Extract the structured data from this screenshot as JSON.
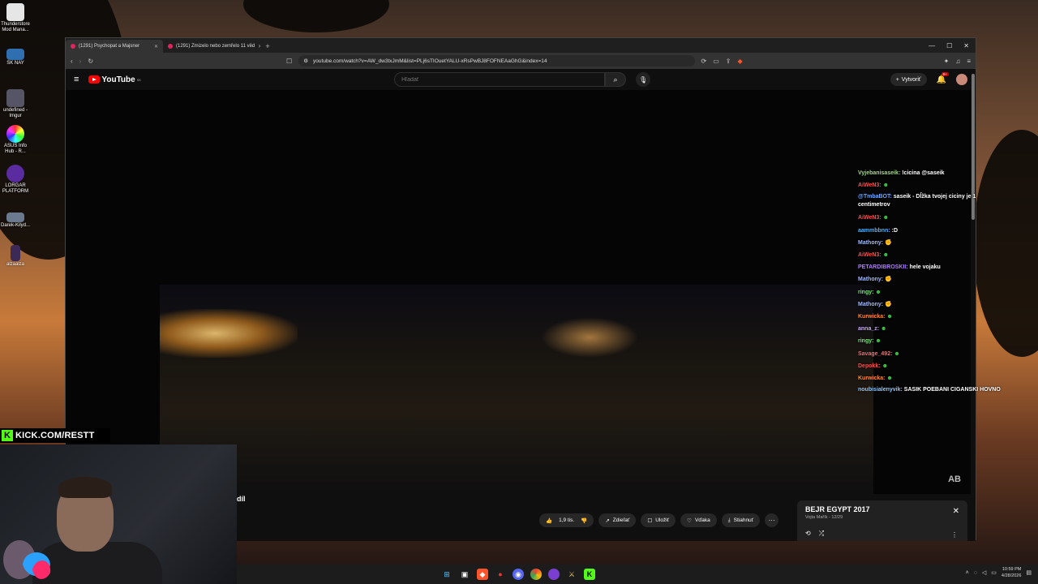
{
  "desktop": {
    "icons": [
      {
        "label": "Thunderstore Mod Mana..."
      },
      {
        "label": "SK NAY"
      },
      {
        "label": "undefined - Imgur"
      },
      {
        "label": "ASUS Info Hub - R..."
      },
      {
        "label": "LORGAR PLATFORM"
      },
      {
        "label": "Darek-Kilyd..."
      },
      {
        "label": "alzaalza"
      }
    ]
  },
  "browser": {
    "tabs": [
      {
        "label": "(1291) Psychopat a Majsner",
        "active": true
      },
      {
        "label": "(1291) Zmizelo nebo zemřelo 11 věd",
        "active": false
      }
    ],
    "new_tab": "+",
    "url": "youtube.com/watch?v=AW_dw3txJmM&list=PLj6sTIOuetYALU-xRsPwBJ8FOFNEAaGhG&index=14",
    "win_controls": [
      "—",
      "☐",
      "✕"
    ]
  },
  "youtube": {
    "logo_text": "YouTube",
    "region": "SK",
    "search_placeholder": "Hľadať",
    "create_label": "Vytvoriť",
    "notif_badge": "9+",
    "chat": [
      {
        "user": "Vyjebanisaseik:",
        "text": "!cicina @saseik",
        "color": "#9be07a"
      },
      {
        "user": "AiWeN3:",
        "text": "☻",
        "color": "#ff4d4d"
      },
      {
        "user": "@TmbaBOT:",
        "text": "saseik - Dĺžka tvojej ciciny je 1 centimetrov",
        "color": "#6aa7ff"
      },
      {
        "user": "AiWeN3:",
        "text": "☻",
        "color": "#ff4d4d"
      },
      {
        "user": "aammbbnn:",
        "text": ":D",
        "color": "#4fb3ff"
      },
      {
        "user": "Mathony:",
        "text": "✊",
        "color": "#9fb7ff"
      },
      {
        "user": "AiWeN3:",
        "text": "☻",
        "color": "#ff4d4d"
      },
      {
        "user": "PETARDIBROSKII:",
        "text": "hele vojaku",
        "color": "#b07cff"
      },
      {
        "user": "Mathony:",
        "text": "✊",
        "color": "#9fb7ff"
      },
      {
        "user": "ringy:",
        "text": "☻",
        "color": "#7de37d"
      },
      {
        "user": "Mathony:",
        "text": "✊",
        "color": "#9fb7ff"
      },
      {
        "user": "Kurwicka:",
        "text": "☻",
        "color": "#ff8a3c"
      },
      {
        "user": "anna_z:",
        "text": "☻",
        "color": "#c9a7ff"
      },
      {
        "user": "ringy:",
        "text": "☻",
        "color": "#7de37d"
      },
      {
        "user": "Savage_492:",
        "text": "☻",
        "color": "#ff6b6b"
      },
      {
        "user": "Depokk:",
        "text": "☻",
        "color": "#ff4d4d"
      },
      {
        "user": "Kurwicka:",
        "text": "☻",
        "color": "#ff8a3c"
      },
      {
        "user": "noubisialenyvik:",
        "text": "SASIK POEBANI CIGANSKI HOVNO",
        "color": "#8ec8ff"
      }
    ],
    "watermark": "AB",
    "actions": {
      "likes": "1,9 tis.",
      "share": "Zdieľať",
      "save": "Uložiť",
      "thanks": "Vďaka",
      "download": "Stiahnuť",
      "more": "···"
    },
    "playlist": {
      "title": "BEJR EGYPT 2017",
      "subtitle": "Vojta Mařík - 12/29",
      "close": "✕"
    }
  },
  "overlay": {
    "kick_letter": "K",
    "kick_text": "KICK.COM/RESTT",
    "subtitle_fragment": "díl"
  },
  "taskbar": {
    "time": "10:59 PM",
    "date": "4/28/2026"
  }
}
